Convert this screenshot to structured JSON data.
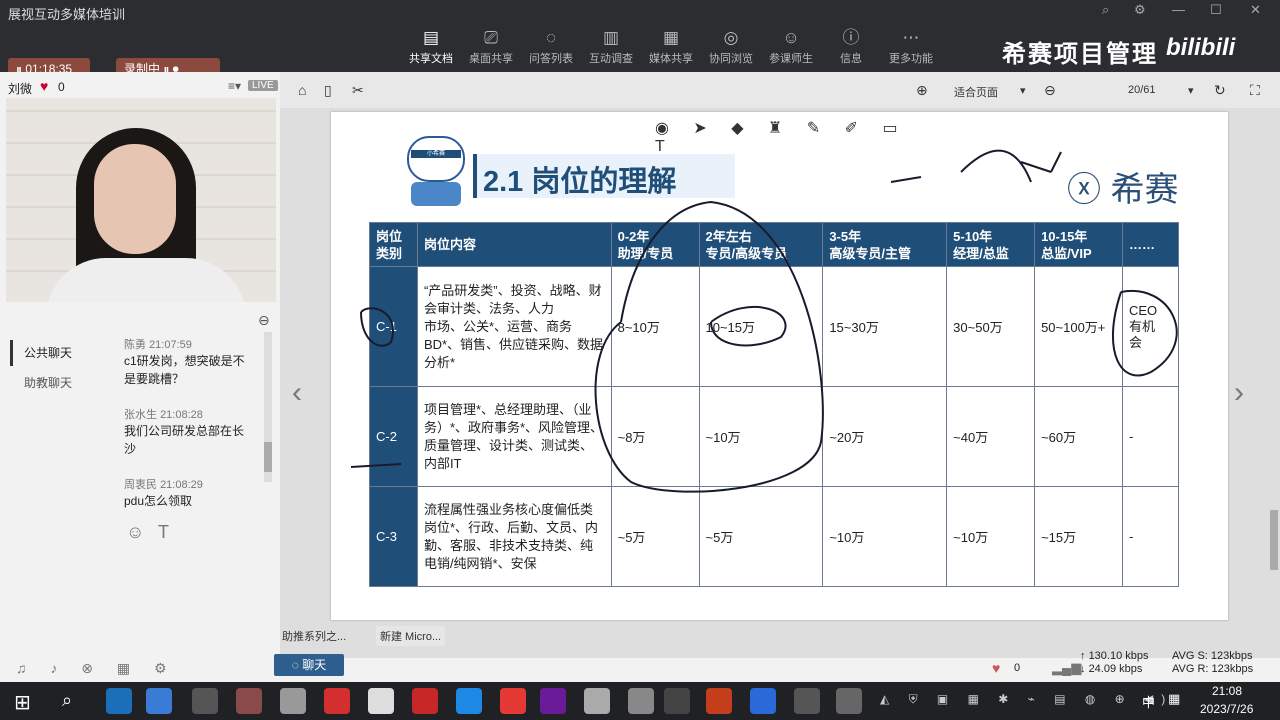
{
  "app": {
    "title": "展视互动多媒体培训",
    "timer": "01:18:35",
    "record": "录制中"
  },
  "toolbar": [
    {
      "label": "共享文档",
      "icon": "doc-share-icon"
    },
    {
      "label": "桌面共享",
      "icon": "desktop-share-icon"
    },
    {
      "label": "问答列表",
      "icon": "qa-icon"
    },
    {
      "label": "互动调查",
      "icon": "survey-icon"
    },
    {
      "label": "媒体共享",
      "icon": "media-icon"
    },
    {
      "label": "协同浏览",
      "icon": "browse-icon"
    },
    {
      "label": "参课师生",
      "icon": "people-icon"
    },
    {
      "label": "信息",
      "icon": "info-icon"
    },
    {
      "label": "更多功能",
      "icon": "more-icon"
    }
  ],
  "brand": {
    "text": "希赛项目管理",
    "logo": "bilibili"
  },
  "presenter": {
    "name": "刘微",
    "likes": "0",
    "badge": "LIVE"
  },
  "chat": {
    "tabs": [
      "公共聊天",
      "助教聊天"
    ],
    "messages": [
      {
        "user": "陈勇",
        "time": "21:07:59",
        "text": "c1研发岗，想突破是不是要跳槽？"
      },
      {
        "user": "张水生",
        "time": "21:08:28",
        "text": "我们公司研发总部在长沙"
      },
      {
        "user": "周衷民",
        "time": "21:08:29",
        "text": "pdu怎么领取"
      }
    ],
    "button": "聊天"
  },
  "doc": {
    "fit": "适合页面",
    "page": "20/61"
  },
  "slide": {
    "title": "2.1 岗位的理解",
    "brand": "希赛",
    "mascot": "小希赛",
    "headers": [
      "岗位\n类别",
      "岗位内容",
      "0-2年\n助理/专员",
      "2年左右\n专员/高级专员",
      "3-5年\n高级专员/主管",
      "5-10年\n经理/总监",
      "10-15年\n总监/VIP",
      "……"
    ],
    "rows": [
      {
        "level": "C-1",
        "content": "“产品研发类”、投资、战略、财会审计类、法务、人力\n市场、公关*、运营、商务BD*、销售、供应链采购、数据分析*",
        "cells": [
          "8~10万",
          "10~15万",
          "15~30万",
          "30~50万",
          "50~100万+",
          "CEO\n有机\n会"
        ]
      },
      {
        "level": "C-2",
        "content": "项目管理*、总经理助理、（业务）*、政府事务*、风险管理、质量管理、设计类、测试类、内部IT",
        "cells": [
          "~8万",
          "~10万",
          "~20万",
          "~40万",
          "~60万",
          "-"
        ]
      },
      {
        "level": "C-3",
        "content": "流程属性强业务核心度偏低类岗位*、行政、后勤、文员、内勤、客服、非技术支持类、纯电销/纯网销*、安保",
        "cells": [
          "~5万",
          "~5万",
          "~10万",
          "~10万",
          "~15万",
          "-"
        ]
      }
    ]
  },
  "bottom": {
    "tabs": [
      "助推系列之...",
      "新建 Micro..."
    ],
    "likes": "0",
    "up": "130.10 kbps",
    "down": "24.09 kbps",
    "avg_s": "AVG S: 123kbps",
    "avg_r": "AVG R: 123kbps"
  },
  "taskbar": {
    "time": "21:08",
    "date": "2023/7/26",
    "ime": "中"
  }
}
